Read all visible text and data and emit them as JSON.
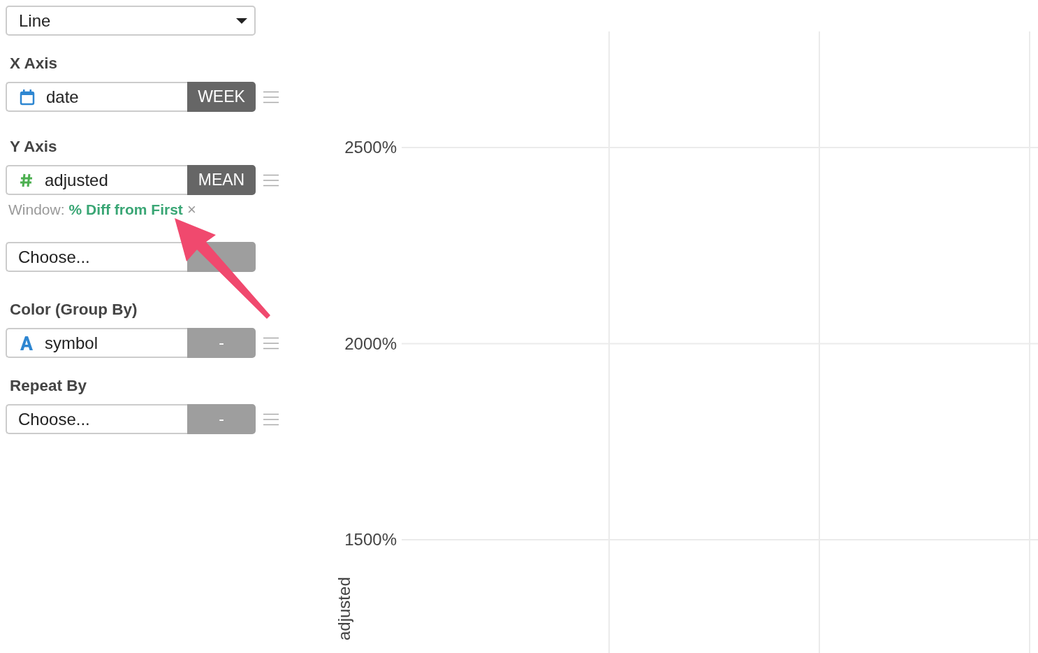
{
  "chart_type": {
    "value": "Line"
  },
  "sections": [
    {
      "title": "X Axis",
      "rows": [
        {
          "kind": "calendar",
          "value": "date",
          "button": "WEEK",
          "button_active": true,
          "menu": true
        }
      ]
    },
    {
      "title": "Y Axis",
      "rows": [
        {
          "kind": "number",
          "value": "adjusted",
          "button": "MEAN",
          "button_active": true,
          "menu": true,
          "window": {
            "label": "Window:",
            "value": "% Diff from First",
            "remove": "×"
          }
        },
        {
          "kind": "empty",
          "value": "Choose...",
          "button_active": false,
          "menu": false
        }
      ]
    },
    {
      "title": "Color (Group By)",
      "rows": [
        {
          "kind": "text",
          "value": "symbol",
          "button": "-",
          "button_active": false,
          "menu": true
        }
      ]
    },
    {
      "title": "Repeat By",
      "rows": [
        {
          "kind": "empty",
          "value": "Choose...",
          "button": "-",
          "button_active": false,
          "menu": true
        }
      ]
    }
  ],
  "chart": {
    "y_label": "adjusted",
    "y_ticks": [
      "2500%",
      "2000%",
      "1500%"
    ]
  }
}
